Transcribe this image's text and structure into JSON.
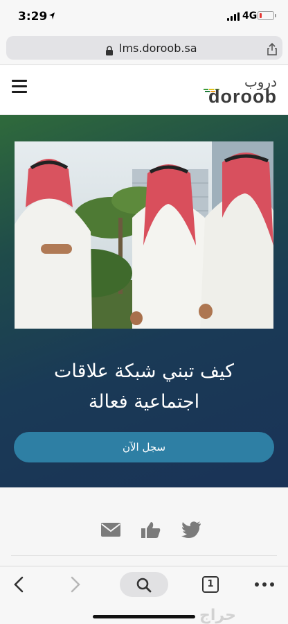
{
  "status_bar": {
    "time": "3:29",
    "network": "4G",
    "battery_level": 0.15,
    "battery_color": "#e53935"
  },
  "browser": {
    "url": "lms.doroob.sa",
    "lock_icon": "lock-icon",
    "share_icon": "share-icon"
  },
  "header": {
    "logo_arabic": "دروب",
    "logo_latin": "doroob",
    "menu_icon": "hamburger-menu-icon"
  },
  "hero": {
    "title_line1": "كيف تبني شبكة علاقات",
    "title_line2": "اجتماعية فعالة",
    "cta_label": "سجل الآن",
    "cta_color": "#2e7fa4"
  },
  "social": {
    "icons": [
      "email-icon",
      "like-icon",
      "twitter-icon"
    ]
  },
  "toolbar": {
    "tab_count": "1",
    "icons": [
      "back-icon",
      "forward-icon",
      "search-icon",
      "tabs-icon",
      "more-icon"
    ]
  },
  "watermark": "حراج",
  "colors": {
    "hero_start": "#2f6a3b",
    "hero_end": "#1a3357",
    "brand_green": "#3b9b3a",
    "brand_yellow": "#e3c21c"
  }
}
